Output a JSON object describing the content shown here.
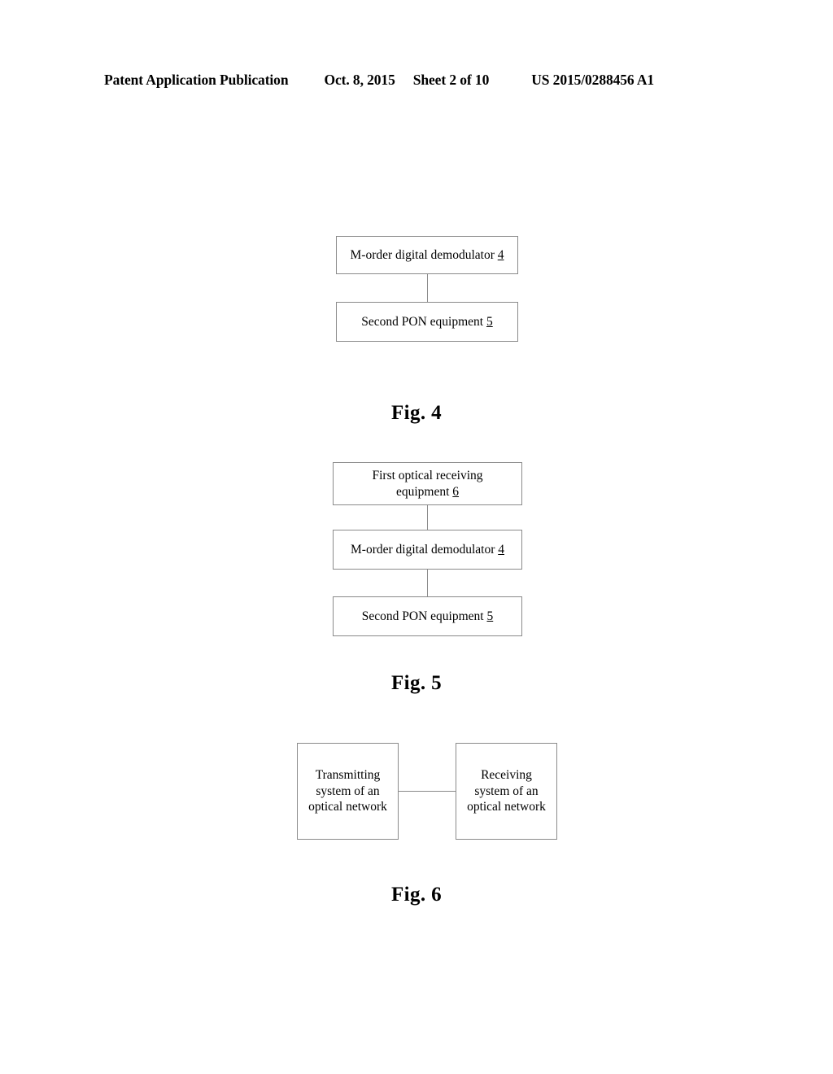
{
  "header": {
    "publication": "Patent Application Publication",
    "date": "Oct. 8, 2015",
    "sheet": "Sheet 2 of 10",
    "doc_number": "US 2015/0288456 A1"
  },
  "figures": [
    {
      "id": "fig4",
      "caption": "Fig. 4",
      "nodes": [
        {
          "id": "fig4-node1",
          "label": "M-order digital demodulator",
          "ref": "4"
        },
        {
          "id": "fig4-node2",
          "label": "Second PON equipment",
          "ref": "5"
        }
      ]
    },
    {
      "id": "fig5",
      "caption": "Fig. 5",
      "nodes": [
        {
          "id": "fig5-node1",
          "label": "First optical receiving\nequipment",
          "ref": "6"
        },
        {
          "id": "fig5-node2",
          "label": "M-order digital demodulator",
          "ref": "4"
        },
        {
          "id": "fig5-node3",
          "label": "Second PON equipment",
          "ref": "5"
        }
      ]
    },
    {
      "id": "fig6",
      "caption": "Fig. 6",
      "nodes": [
        {
          "id": "fig6-node1",
          "label": "Transmitting\nsystem of an\noptical network",
          "ref": ""
        },
        {
          "id": "fig6-node2",
          "label": "Receiving\nsystem of an\noptical network",
          "ref": ""
        }
      ]
    }
  ],
  "colors": {
    "page_background": "#ffffff",
    "ink": "#000000",
    "box_border": "#8a8a8a",
    "connector": "#8a8a8a"
  }
}
